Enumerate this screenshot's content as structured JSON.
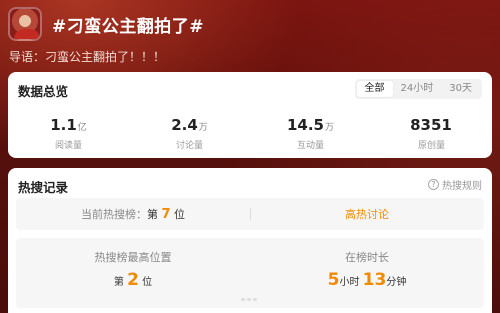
{
  "header": {
    "title": "#刁蛮公主翻拍了#"
  },
  "intro": "导语：刁蛮公主翻拍了！！！",
  "overview": {
    "title": "数据总览",
    "tabs": [
      "全部",
      "24小时",
      "30天"
    ],
    "stats": [
      {
        "value": "1.1",
        "unit": "亿",
        "label": "阅读量"
      },
      {
        "value": "2.4",
        "unit": "万",
        "label": "讨论量"
      },
      {
        "value": "14.5",
        "unit": "万",
        "label": "互动量"
      },
      {
        "value": "8351",
        "unit": "",
        "label": "原创量"
      }
    ]
  },
  "hot": {
    "title": "热搜记录",
    "rule_label": "热搜规则",
    "current_rank_prefix": "当前热搜榜：",
    "current_rank_pre": "第",
    "current_rank_value": "7",
    "current_rank_post": "位",
    "hot_tag": "高热讨论",
    "peak_label": "热搜榜最高位置",
    "peak_pre": "第",
    "peak_value": "2",
    "peak_post": "位",
    "duration_label": "在榜时长",
    "duration_hours": "5",
    "duration_hours_unit": "小时",
    "duration_minutes": "13",
    "duration_minutes_unit": "分钟"
  },
  "colors": {
    "accent": "#f08a00",
    "background": "#6a100c"
  }
}
